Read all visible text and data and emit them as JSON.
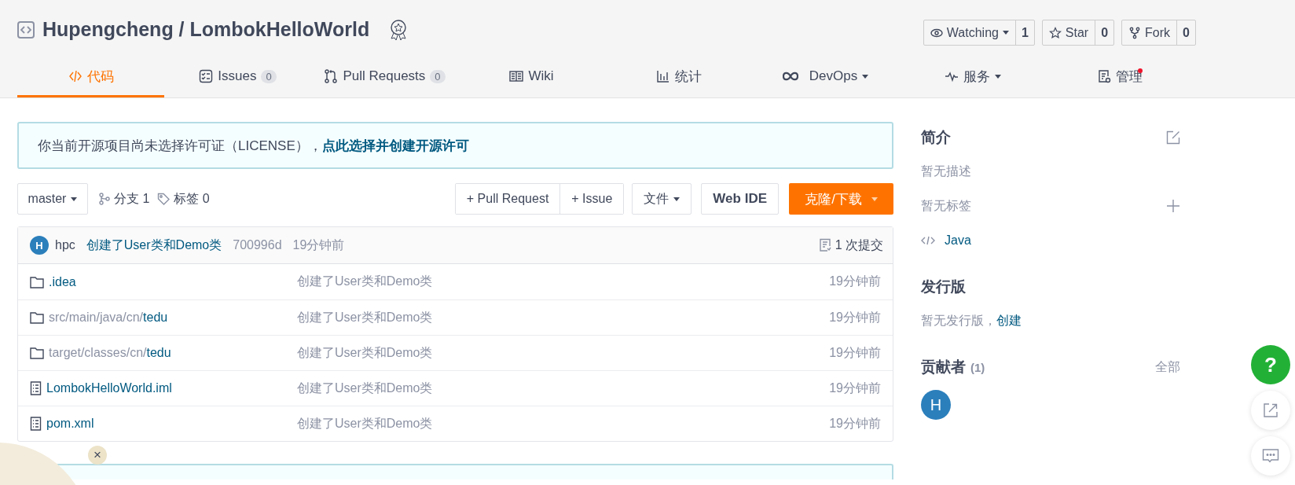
{
  "repo": {
    "title": "Hupengcheng / LombokHelloWorld"
  },
  "actions": [
    {
      "label": "Watching",
      "dropdown": true,
      "count": "1"
    },
    {
      "label": "Star",
      "dropdown": false,
      "count": "0"
    },
    {
      "label": "Fork",
      "dropdown": false,
      "count": "0"
    }
  ],
  "tabs": [
    {
      "label": "代码",
      "selected": true
    },
    {
      "label": "Issues",
      "count": "0",
      "selected": false
    },
    {
      "label": "Pull Requests",
      "count": "0",
      "selected": false
    },
    {
      "label": "Wiki",
      "selected": false
    },
    {
      "label": "统计",
      "selected": false
    },
    {
      "label": "DevOps",
      "dropdown": true,
      "selected": false
    },
    {
      "label": "服务",
      "dropdown": true,
      "selected": false
    },
    {
      "label": "管理",
      "notification": true,
      "selected": false
    }
  ],
  "notice": {
    "text": "你当前开源项目尚未选择许可证（LICENSE），",
    "link": "点此选择并创建开源许可"
  },
  "toolbar": {
    "branch": "master",
    "branches": "分支 1",
    "tags": "标签 0",
    "new_buttons": [
      "+ Pull Request",
      "+ Issue"
    ],
    "file_menu": "文件",
    "web_ide": "Web IDE",
    "clone": "克隆/下载"
  },
  "last_commit": {
    "avatar": "H",
    "author": "hpc",
    "message": "创建了User类和Demo类",
    "hash": "700996d",
    "time": "19分钟前",
    "commits": "1 次提交"
  },
  "files": [
    {
      "kind": "folder",
      "name": ".idea",
      "message": "创建了User类和Demo类",
      "time": "19分钟前"
    },
    {
      "kind": "folder",
      "prefix": "src/main/java/cn/",
      "name": "tedu",
      "message": "创建了User类和Demo类",
      "time": "19分钟前"
    },
    {
      "kind": "folder",
      "prefix": "target/classes/cn/",
      "name": "tedu",
      "message": "创建了User类和Demo类",
      "time": "19分钟前"
    },
    {
      "kind": "file",
      "name": "LombokHelloWorld.iml",
      "message": "创建了User类和Demo类",
      "time": "19分钟前"
    },
    {
      "kind": "file",
      "name": "pom.xml",
      "message": "创建了User类和Demo类",
      "time": "19分钟前"
    }
  ],
  "sidebar": {
    "about": {
      "title": "简介",
      "description": "暂无描述",
      "tags": "暂无标签",
      "language": "Java"
    },
    "releases": {
      "title": "发行版",
      "text": "暂无发行版，",
      "link": "创建"
    },
    "contributors": {
      "title": "贡献者",
      "count": "(1)",
      "all": "全部",
      "avatars": [
        "H"
      ]
    }
  },
  "float": {
    "help": "?"
  },
  "widget": {
    "close": "×"
  }
}
